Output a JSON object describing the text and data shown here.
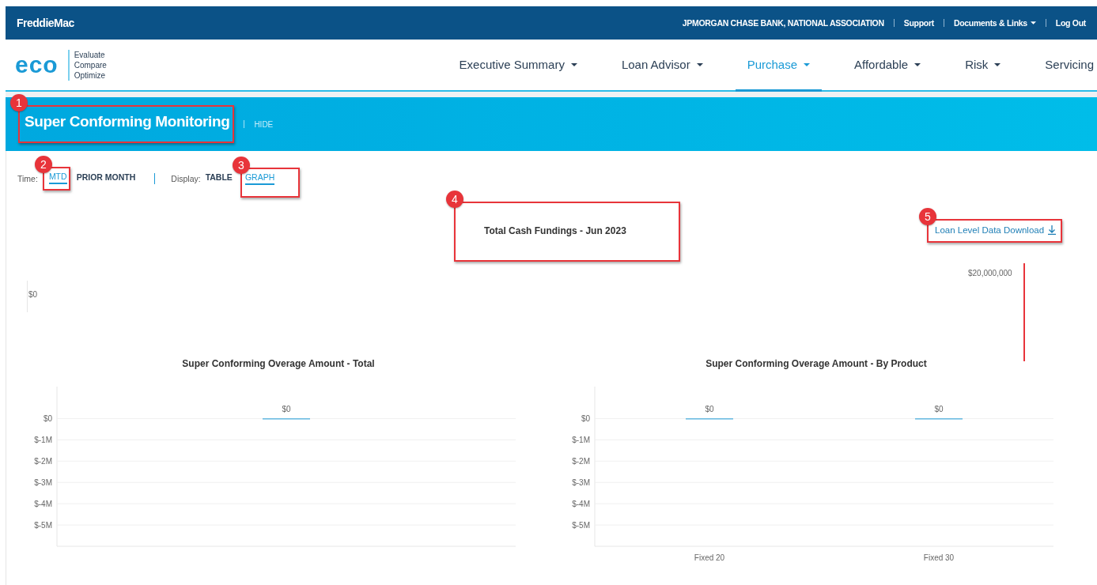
{
  "top_bar": {
    "brand": "FreddieMac",
    "links": [
      {
        "label": "JPMORGAN CHASE BANK, NATIONAL ASSOCIATION",
        "dropdown": false
      },
      {
        "label": "Support",
        "dropdown": false
      },
      {
        "label": "Documents & Links",
        "dropdown": true
      },
      {
        "label": "Log Out",
        "dropdown": false
      }
    ]
  },
  "app_logo": {
    "name": "eco",
    "tagline": [
      "Evaluate",
      "Compare",
      "Optimize"
    ]
  },
  "nav": [
    {
      "label": "Executive Summary",
      "dropdown": true,
      "selected": false
    },
    {
      "label": "Loan Advisor",
      "dropdown": true,
      "selected": false
    },
    {
      "label": "Purchase",
      "dropdown": true,
      "selected": true
    },
    {
      "label": "Affordable",
      "dropdown": true,
      "selected": false
    },
    {
      "label": "Risk",
      "dropdown": true,
      "selected": false
    },
    {
      "label": "Servicing",
      "dropdown": false,
      "selected": false
    }
  ],
  "banner": {
    "title": "Super Conforming Monitoring",
    "callout": "1",
    "toggle": "HIDE"
  },
  "filters": {
    "time_label": "Time:",
    "time_options": [
      {
        "label": "MTD",
        "selected": true,
        "callout": "2"
      },
      {
        "label": "PRIOR MONTH",
        "selected": false
      }
    ],
    "display_label": "Display:",
    "display_options": [
      {
        "label": "TABLE",
        "selected": false
      },
      {
        "label": "GRAPH",
        "selected": true,
        "callout": "3"
      }
    ]
  },
  "cash_chart": {
    "title": "Total Cash Fundings - Jun 2023",
    "callout": "4",
    "left_label": "$0",
    "right_label": "$20,000,000"
  },
  "download_link": {
    "label": "Loan Level Data Download",
    "callout": "5"
  },
  "charts": [
    {
      "chart_data": {
        "type": "bar",
        "title": "Super Conforming Overage Amount - Total",
        "values": [
          0
        ],
        "value_labels": [
          "$0"
        ],
        "grid": true,
        "ylim": [
          -6000000,
          1500000
        ],
        "yticks": [
          {
            "value": 0,
            "label": "$0"
          },
          {
            "value": -1000000,
            "label": "$-1M"
          },
          {
            "value": -2000000,
            "label": "$-2M"
          },
          {
            "value": -3000000,
            "label": "$-3M"
          },
          {
            "value": -4000000,
            "label": "$-4M"
          },
          {
            "value": -5000000,
            "label": "$-5M"
          }
        ]
      }
    },
    {
      "chart_data": {
        "type": "bar",
        "title": "Super Conforming Overage Amount - By Product",
        "categories": [
          "Fixed 20",
          "Fixed 30"
        ],
        "values": [
          0,
          0
        ],
        "value_labels": [
          "$0",
          "$0"
        ],
        "grid": true,
        "ylim": [
          -6000000,
          1500000
        ],
        "yticks": [
          {
            "value": 0,
            "label": "$0"
          },
          {
            "value": -1000000,
            "label": "$-1M"
          },
          {
            "value": -2000000,
            "label": "$-2M"
          },
          {
            "value": -3000000,
            "label": "$-3M"
          },
          {
            "value": -4000000,
            "label": "$-4M"
          },
          {
            "value": -5000000,
            "label": "$-5M"
          }
        ]
      }
    }
  ]
}
